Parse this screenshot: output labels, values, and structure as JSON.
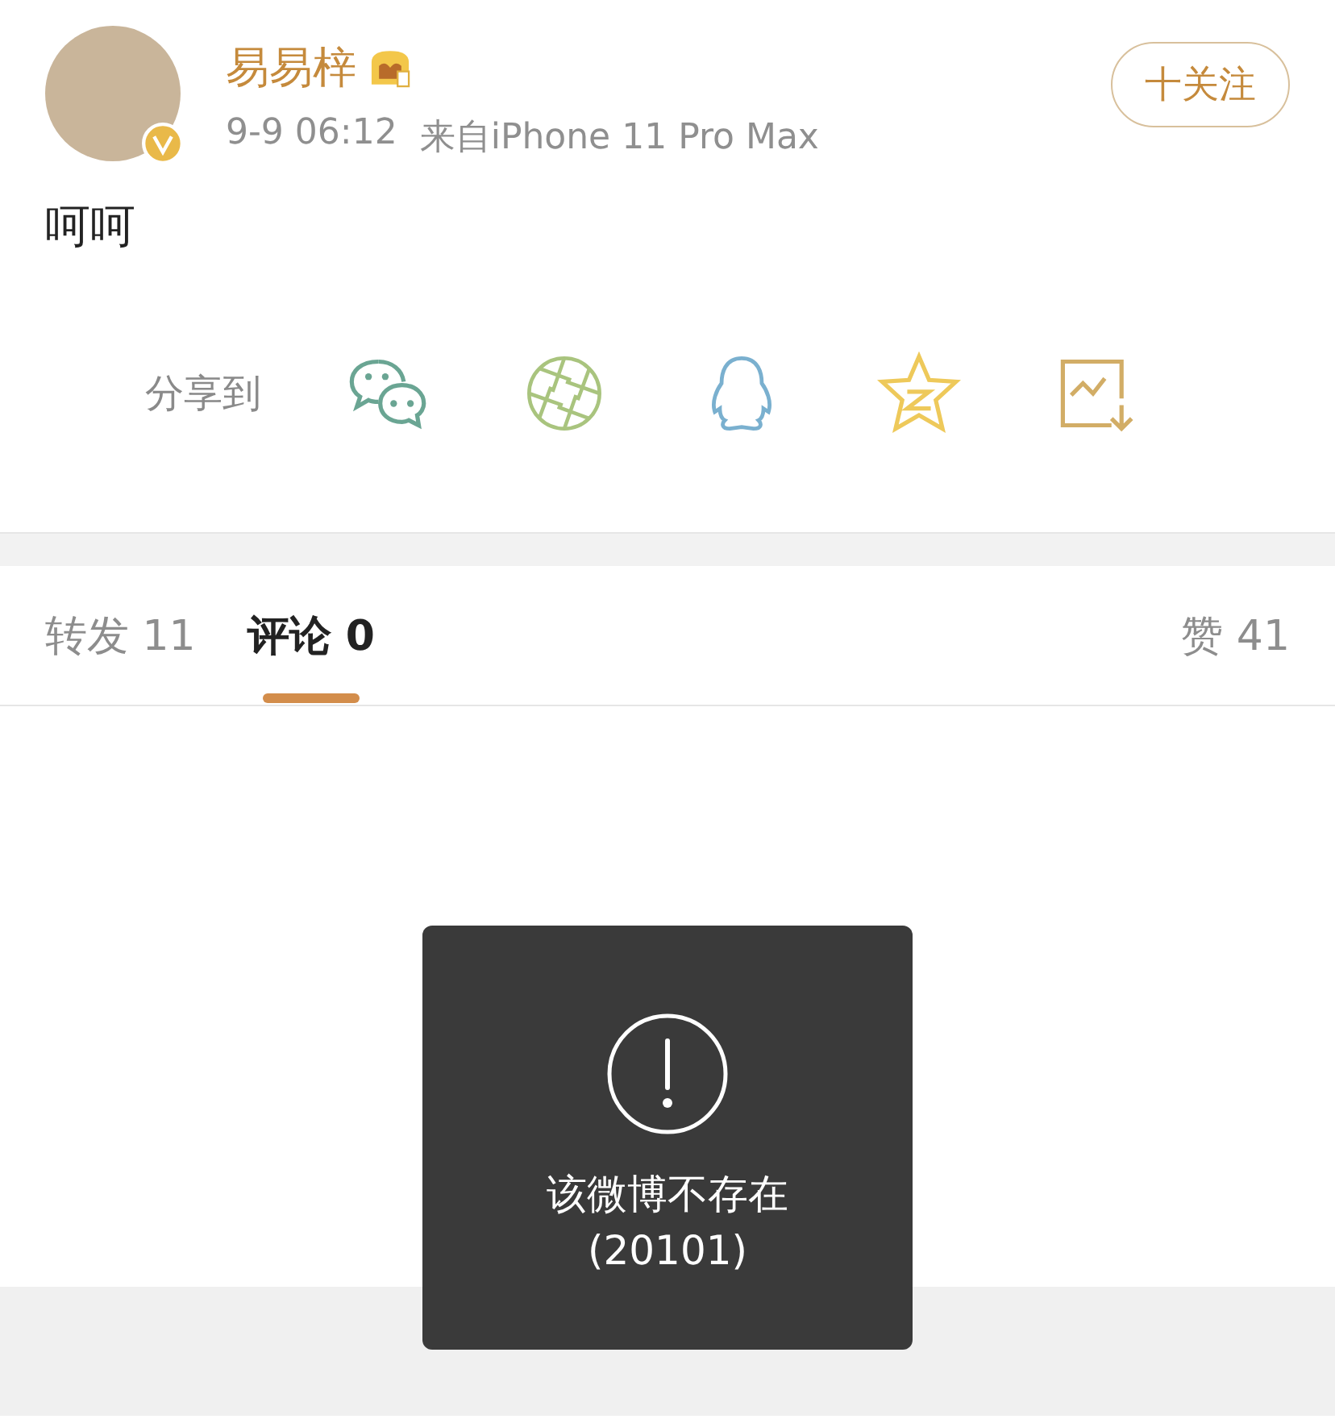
{
  "post": {
    "author": "易易梓",
    "timestamp": "9-9 06:12",
    "source": "来自iPhone 11 Pro Max",
    "follow_button": "十关注",
    "text": "呵呵",
    "verified": true
  },
  "share": {
    "label": "分享到"
  },
  "tabs": [
    {
      "label": "转发 11",
      "selected": false
    },
    {
      "label": "评论 0",
      "selected": true
    },
    {
      "label": "赞 41",
      "selected": false
    }
  ],
  "toast": {
    "message": "该微博不存在",
    "code": "(20101)"
  }
}
